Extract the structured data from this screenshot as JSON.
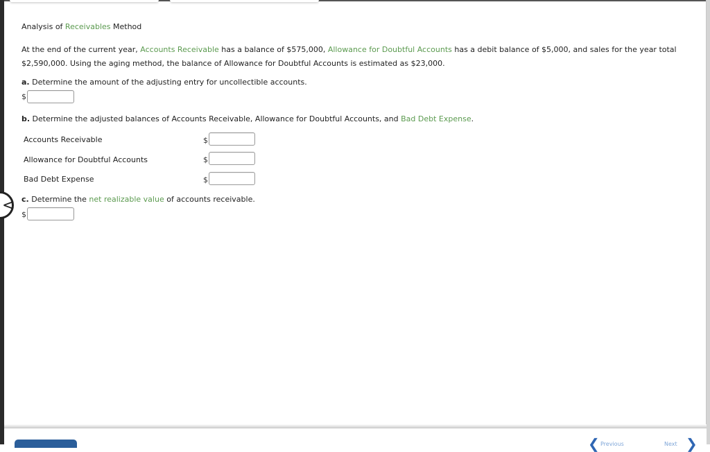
{
  "title": {
    "prefix": "Analysis of ",
    "link": "Receivables",
    "suffix": " Method"
  },
  "problem": {
    "p1": "At the end of the current year, ",
    "link1": "Accounts Receivable",
    "p2": " has a balance of $575,000, ",
    "link2": "Allowance for Doubtful Accounts",
    "p3": " has a debit balance of $5,000, and sales for the year total $2,590,000. Using the aging method, the balance of Allowance for Doubtful Accounts is estimated as $23,000."
  },
  "part_a": {
    "letter": "a.",
    "text": " Determine the amount of the adjusting entry for uncollectible accounts.",
    "currency": "$",
    "value": ""
  },
  "part_b": {
    "letter": "b.",
    "text": " Determine the adjusted balances of Accounts Receivable, Allowance for Doubtful Accounts, and ",
    "link": "Bad Debt Expense",
    "end": ".",
    "rows": [
      {
        "label": "Accounts Receivable",
        "currency": "$",
        "value": ""
      },
      {
        "label": "Allowance for Doubtful Accounts",
        "currency": "$",
        "value": ""
      },
      {
        "label": "Bad Debt Expense",
        "currency": "$",
        "value": ""
      }
    ]
  },
  "part_c": {
    "letter": "c.",
    "text_pre": " Determine the ",
    "link": "net realizable value",
    "text_post": " of accounts receivable.",
    "currency": "$",
    "value": ""
  },
  "nav": {
    "back_glyph": "<",
    "prev_glyph": "❮",
    "next_glyph": "❯",
    "prev_label": "Previous",
    "next_label": "Next"
  },
  "colors": {
    "link_green": "#5b9a4f",
    "button_blue": "#2b5e9a",
    "nav_blue": "#2f66b3"
  }
}
